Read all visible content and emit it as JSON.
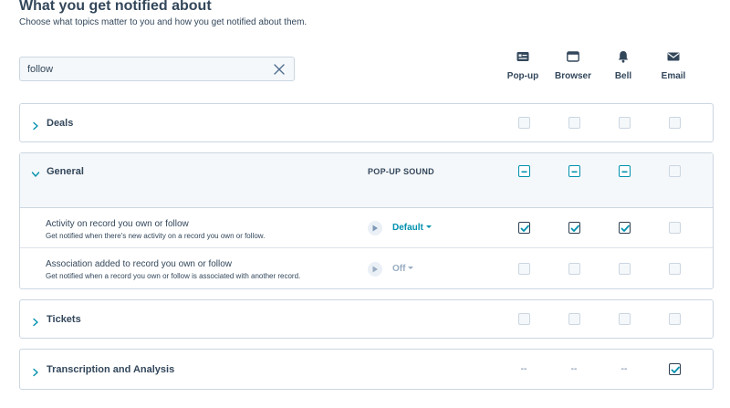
{
  "header": {
    "title": "What you get notified about",
    "subtitle": "Choose what topics matter to you and how you get notified about them."
  },
  "search": {
    "value": "follow",
    "placeholder": ""
  },
  "columns": [
    {
      "key": "popup",
      "label": "Pop-up",
      "icon": "popup-icon"
    },
    {
      "key": "browser",
      "label": "Browser",
      "icon": "browser-icon"
    },
    {
      "key": "bell",
      "label": "Bell",
      "icon": "bell-icon"
    },
    {
      "key": "email",
      "label": "Email",
      "icon": "email-icon"
    }
  ],
  "colors": {
    "text": "#33475b",
    "accent": "#0091ae",
    "border": "#cbd6e2",
    "muted": "#99acc2"
  },
  "categories": {
    "deals": {
      "label": "Deals",
      "expanded": false,
      "state": [
        "unchecked",
        "unchecked",
        "unchecked",
        "unchecked"
      ]
    },
    "general": {
      "label": "General",
      "expanded": true,
      "sound_header": "POP-UP SOUND",
      "state": [
        "indeterminate",
        "indeterminate",
        "indeterminate",
        "unchecked"
      ],
      "rows": [
        {
          "title": "Activity on record you own or follow",
          "description": "Get notified when there's new activity on a record you own or follow.",
          "sound": "Default",
          "state": [
            "checked",
            "checked",
            "checked",
            "unchecked"
          ]
        },
        {
          "title": "Association added to record you own or follow",
          "description": "Get notified when a record you own or follow is associated with another record.",
          "sound": "Off",
          "state": [
            "unchecked",
            "unchecked",
            "unchecked",
            "unchecked"
          ]
        }
      ]
    },
    "tickets": {
      "label": "Tickets",
      "expanded": false,
      "state": [
        "unchecked",
        "unchecked",
        "unchecked",
        "unchecked"
      ]
    },
    "transcription": {
      "label": "Transcription and Analysis",
      "expanded": false,
      "dash": "--",
      "state": [
        "na",
        "na",
        "na",
        "checked"
      ]
    }
  }
}
